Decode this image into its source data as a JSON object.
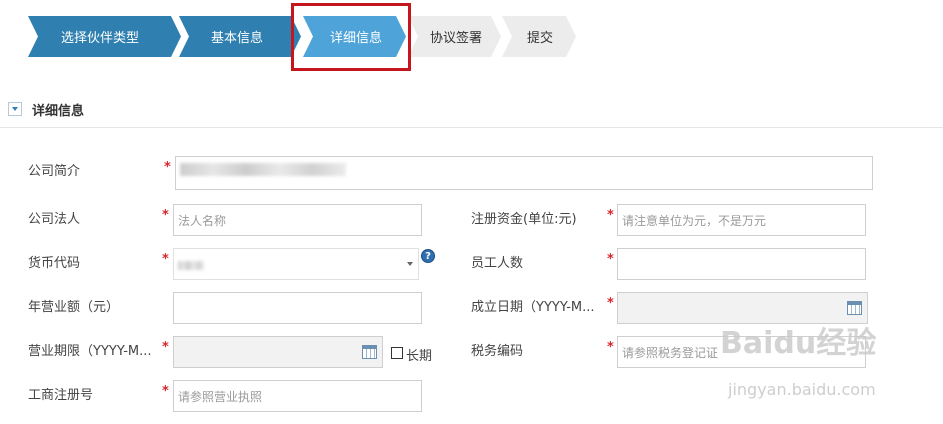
{
  "wizard": {
    "steps": [
      {
        "label": "选择伙伴类型",
        "state": "done"
      },
      {
        "label": "基本信息",
        "state": "done"
      },
      {
        "label": "详细信息",
        "state": "active"
      },
      {
        "label": "协议签署",
        "state": "todo"
      },
      {
        "label": "提交",
        "state": "todo"
      }
    ],
    "colors": {
      "done": "#2f7fb0",
      "active": "#4ea3d8",
      "todo": "#ececec",
      "highlight": "#c4161c"
    }
  },
  "section": {
    "title": "详细信息"
  },
  "form": {
    "company_intro_label": "公司简介",
    "legal_person_label": "公司法人",
    "legal_person_placeholder": "法人名称",
    "registered_capital_label": "注册资金(单位:元)",
    "registered_capital_placeholder": "请注意单位为元，不是万元",
    "currency_code_label": "货币代码",
    "employee_count_label": "员工人数",
    "annual_revenue_label": "年营业额（元）",
    "founded_date_label": "成立日期（YYYY-M...",
    "business_term_label": "营业期限（YYYY-M...",
    "long_term_label": "长期",
    "tax_code_label": "税务编码",
    "tax_code_placeholder": "请参照税务登记证",
    "business_reg_no_label": "工商注册号",
    "business_reg_no_placeholder": "请参照营业执照",
    "required_mark": "*",
    "help_glyph": "?"
  },
  "watermark": {
    "text": "Baidu经验",
    "sub": "jingyan.baidu.com"
  }
}
